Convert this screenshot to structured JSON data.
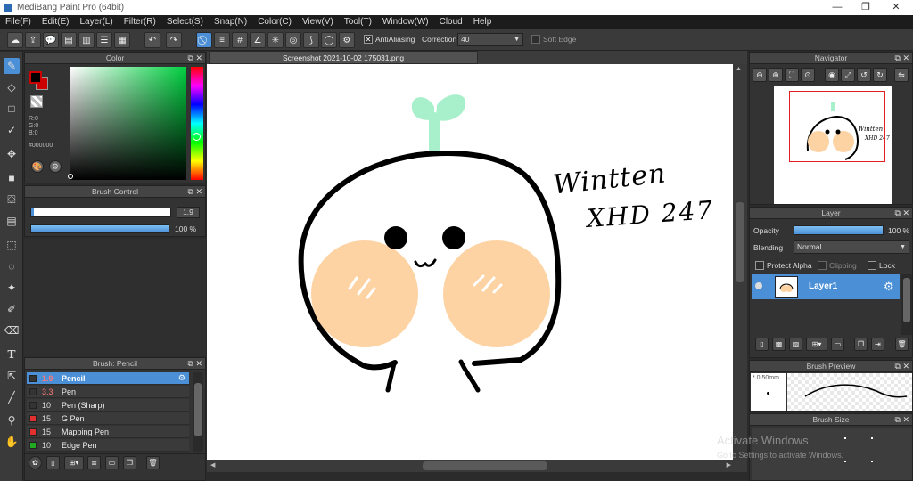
{
  "window": {
    "title": "MediBang Paint Pro (64bit)",
    "controls": [
      "—",
      "❐",
      "✕"
    ]
  },
  "menu": [
    "File(F)",
    "Edit(E)",
    "Layer(L)",
    "Filter(R)",
    "Select(S)",
    "Snap(N)",
    "Color(C)",
    "View(V)",
    "Tool(T)",
    "Window(W)",
    "Cloud",
    "Help"
  ],
  "toolbar": {
    "antialias_label": "AntiAliasing",
    "correction_label": "Correction",
    "correction_value": "40",
    "soft_edge_label": "Soft Edge"
  },
  "color_panel": {
    "title": "Color",
    "r": "R:0",
    "g": "G:0",
    "b": "B:0",
    "hex": "#000000",
    "foreground": "#000000",
    "background_color": "#cc0000"
  },
  "brush_control": {
    "title": "Brush Control",
    "size_value": "1.9",
    "opacity_value": "100 %"
  },
  "brush_list": {
    "title": "Brush: Pencil",
    "items": [
      {
        "size": "1.9",
        "name": "Pencil",
        "color": "#333333",
        "selected": true
      },
      {
        "size": "3.3",
        "name": "Pen",
        "color": "#333333"
      },
      {
        "size": "10",
        "name": "Pen (Sharp)",
        "color": "#333333"
      },
      {
        "size": "15",
        "name": "G Pen",
        "color": "#e03030"
      },
      {
        "size": "15",
        "name": "Mapping Pen",
        "color": "#e03030"
      },
      {
        "size": "10",
        "name": "Edge Pen",
        "color": "#22aa22"
      }
    ]
  },
  "canvas": {
    "tab_title": "Screenshot 2021-10-02 175031.png",
    "handwriting_line1": "Wintten",
    "handwriting_line2": "XHD 247"
  },
  "navigator": {
    "title": "Navigator"
  },
  "layer_panel": {
    "title": "Layer",
    "opacity_label": "Opacity",
    "opacity_value": "100 %",
    "blending_label": "Blending",
    "blending_value": "Normal",
    "protect_alpha_label": "Protect Alpha",
    "clipping_label": "Clipping",
    "lock_label": "Lock",
    "layer_name": "Layer1"
  },
  "brush_preview": {
    "title": "Brush Preview",
    "size_label": "* 0.50mm"
  },
  "brush_size": {
    "title": "Brush Size"
  },
  "watermark": {
    "line1": "Activate Windows",
    "line2": "Go to Settings to activate Windows."
  },
  "colors": {
    "accent": "#4b8fd6",
    "cheek": "#fdd3a4",
    "sprout": "#a8f0cc"
  }
}
